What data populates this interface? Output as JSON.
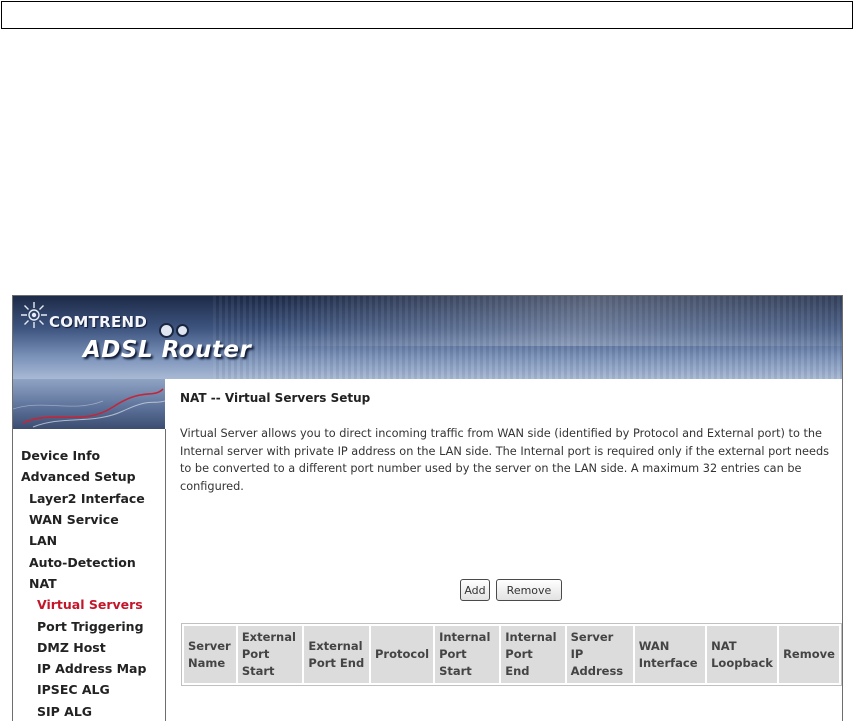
{
  "brand": {
    "company": "COMTREND",
    "product": "ADSL Router"
  },
  "sidebar": {
    "items": [
      {
        "label": "Device Info",
        "level": 0
      },
      {
        "label": "Advanced Setup",
        "level": 0
      },
      {
        "label": "Layer2 Interface",
        "level": 1
      },
      {
        "label": "WAN Service",
        "level": 1
      },
      {
        "label": "LAN",
        "level": 1
      },
      {
        "label": "Auto-Detection",
        "level": 1
      },
      {
        "label": "NAT",
        "level": 1
      },
      {
        "label": "Virtual Servers",
        "level": 2,
        "active": true
      },
      {
        "label": "Port Triggering",
        "level": 2
      },
      {
        "label": "DMZ Host",
        "level": 2
      },
      {
        "label": "IP Address Map",
        "level": 2
      },
      {
        "label": "IPSEC ALG",
        "level": 2
      },
      {
        "label": "SIP ALG",
        "level": 2
      }
    ]
  },
  "main": {
    "title": "NAT -- Virtual Servers Setup",
    "description": "Virtual Server allows you to direct incoming traffic from WAN side (identified by Protocol and External port) to the Internal server with private IP address on the LAN side. The Internal port is required only if the external port needs to be converted to a different port number used by the server on the LAN side. A maximum 32 entries can be configured.",
    "add_label": "Add",
    "remove_label": "Remove",
    "table": {
      "headers": [
        "Server Name",
        "External Port Start",
        "External Port End",
        "Protocol",
        "Internal Port Start",
        "Internal Port End",
        "Server IP Address",
        "WAN Interface",
        "NAT Loopback",
        "Remove"
      ],
      "rows": []
    }
  },
  "colors": {
    "active_nav": "#c4162a",
    "header_bg": "#dcdcdc",
    "banner": "#3f5681"
  }
}
